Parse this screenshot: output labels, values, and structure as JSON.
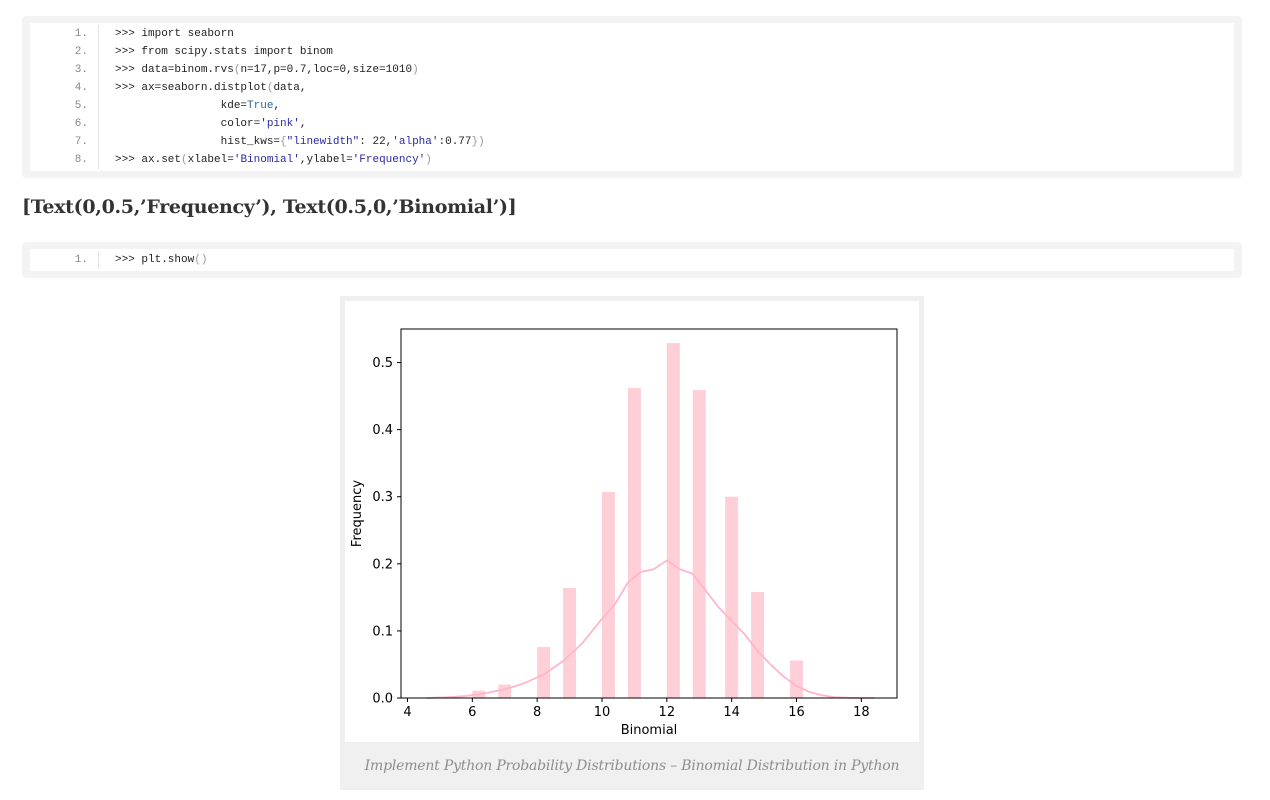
{
  "code_block_1": {
    "lines": [
      {
        "num": "1.",
        "text": ">>> import seaborn"
      },
      {
        "num": "2.",
        "text": ">>> from scipy.stats import binom"
      },
      {
        "num": "3.",
        "text": ">>> data=binom.rvs(n=17,p=0.7,loc=0,size=1010)"
      },
      {
        "num": "4.",
        "text": ">>> ax=seaborn.distplot(data,"
      },
      {
        "num": "5.",
        "text": "                kde=True,"
      },
      {
        "num": "6.",
        "text": "                color='pink',"
      },
      {
        "num": "7.",
        "text": "                hist_kws={\"linewidth\": 22,'alpha':0.77})"
      },
      {
        "num": "8.",
        "text": ">>> ax.set(xlabel='Binomial',ylabel='Frequency')"
      }
    ]
  },
  "output_text": "[Text(0,0.5,’Frequency’), Text(0.5,0,’Binomial’)]",
  "code_block_2": {
    "lines": [
      {
        "num": "1.",
        "text": ">>> plt.show()"
      }
    ]
  },
  "caption": "Implement Python Probability Distributions – Binomial Distribution in Python",
  "chart_data": {
    "type": "bar",
    "xlabel": "Binomial",
    "ylabel": "Frequency",
    "xlim": [
      3.8,
      19.1
    ],
    "ylim": [
      0,
      0.55
    ],
    "xticks": [
      4,
      6,
      8,
      10,
      12,
      14,
      16,
      18
    ],
    "yticks": [
      0.0,
      0.1,
      0.2,
      0.3,
      0.4,
      0.5
    ],
    "ytick_labels": [
      "0.0",
      "0.1",
      "0.2",
      "0.3",
      "0.4",
      "0.5"
    ],
    "bar_color": "#ffc0cb",
    "bar_alpha": 0.77,
    "bars": [
      {
        "x": 6.2,
        "value": 0.011
      },
      {
        "x": 7.0,
        "value": 0.02
      },
      {
        "x": 8.2,
        "value": 0.076
      },
      {
        "x": 9.0,
        "value": 0.164
      },
      {
        "x": 10.2,
        "value": 0.307
      },
      {
        "x": 11.0,
        "value": 0.462
      },
      {
        "x": 12.2,
        "value": 0.529
      },
      {
        "x": 13.0,
        "value": 0.459
      },
      {
        "x": 14.0,
        "value": 0.3
      },
      {
        "x": 14.8,
        "value": 0.158
      },
      {
        "x": 16.0,
        "value": 0.056
      }
    ],
    "bar_width": 0.4,
    "kde": {
      "color": "#ffb6c8",
      "x": [
        4.6,
        5.2,
        5.8,
        6.4,
        7.0,
        7.6,
        8.2,
        8.8,
        9.4,
        10.0,
        10.4,
        10.8,
        11.2,
        11.6,
        12.0,
        12.4,
        12.8,
        13.2,
        13.6,
        14.0,
        14.4,
        14.8,
        15.2,
        15.6,
        16.0,
        16.4,
        16.8,
        17.2,
        17.8,
        18.4
      ],
      "y": [
        0.0,
        0.001,
        0.003,
        0.007,
        0.013,
        0.022,
        0.035,
        0.055,
        0.082,
        0.118,
        0.14,
        0.172,
        0.188,
        0.192,
        0.205,
        0.192,
        0.185,
        0.16,
        0.135,
        0.115,
        0.095,
        0.07,
        0.05,
        0.032,
        0.018,
        0.009,
        0.004,
        0.001,
        0.0,
        0.0
      ]
    }
  }
}
